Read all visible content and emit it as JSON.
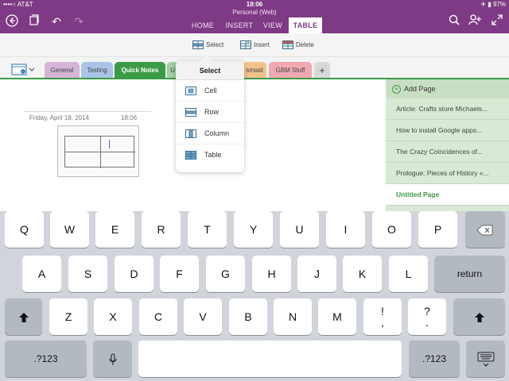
{
  "status_bar": {
    "carrier": "••••○ AT&T",
    "time": "18:06",
    "battery": "97%"
  },
  "header": {
    "notebook_title": "Personal (Web)",
    "tabs": [
      {
        "label": "HOME",
        "active": false
      },
      {
        "label": "INSERT",
        "active": false
      },
      {
        "label": "VIEW",
        "active": false
      },
      {
        "label": "TABLE",
        "active": true
      }
    ]
  },
  "ribbon": {
    "select_label": "Select",
    "insert_label": "Insert",
    "delete_label": "Delete"
  },
  "sections": {
    "tabs": [
      {
        "label": "General",
        "color": "#d6b4d8"
      },
      {
        "label": "Testing",
        "color": "#a9c4e6"
      },
      {
        "label": "Quick Notes",
        "color": "#3c9b46",
        "active": true
      },
      {
        "label": "U",
        "color": "#9fd0a3"
      },
      {
        "label": "smaid",
        "color": "#f3c38b"
      },
      {
        "label": "GBM Stuff",
        "color": "#f1a9b2"
      },
      {
        "label": "+",
        "color": "#d9d9d9"
      }
    ]
  },
  "page": {
    "date": "Friday, April 18, 2014",
    "time": "18:06"
  },
  "page_list": {
    "add_label": "Add Page",
    "items": [
      "Article: Crafts store Michaels...",
      "How to install Google apps...",
      "The Crazy Coincidences of...",
      "Prologue: Pieces of History «..."
    ],
    "current": "Untitled Page"
  },
  "select_menu": {
    "title": "Select",
    "items": [
      "Cell",
      "Row",
      "Column",
      "Table"
    ]
  },
  "keyboard": {
    "row1": [
      "Q",
      "W",
      "E",
      "R",
      "T",
      "Y",
      "U",
      "I",
      "O",
      "P"
    ],
    "row2": [
      "A",
      "S",
      "D",
      "F",
      "G",
      "H",
      "J",
      "K",
      "L"
    ],
    "row3": [
      "Z",
      "X",
      "C",
      "V",
      "B",
      "N",
      "M",
      "!\n,",
      "?\n."
    ],
    "return_label": "return",
    "numbers_label": ".?123"
  },
  "colors": {
    "brand": "#7e3a84",
    "section_green": "#3c9b46"
  }
}
